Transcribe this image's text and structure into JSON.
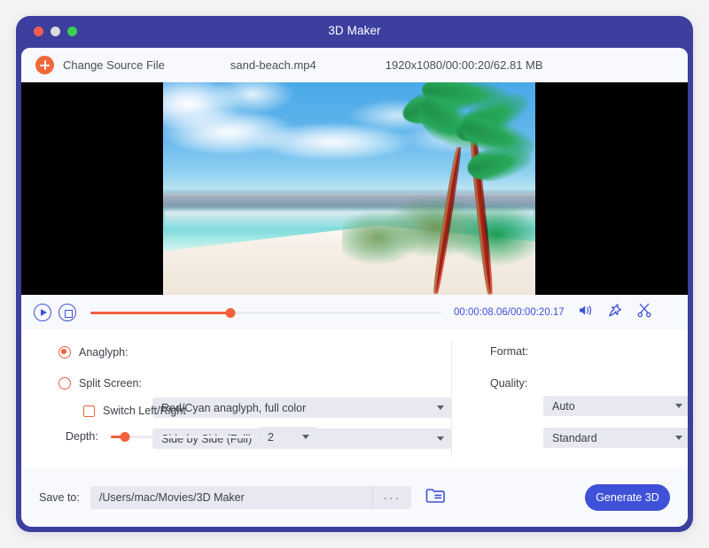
{
  "window": {
    "title": "3D Maker",
    "traffic_lights": [
      "close",
      "minimize",
      "zoom"
    ]
  },
  "source_bar": {
    "add_icon": "plus-circle-icon",
    "change_source_label": "Change Source File",
    "file_name": "sand-beach.mp4",
    "file_meta": "1920x1080/00:00:20/62.81 MB"
  },
  "preview": {
    "mode": "anaglyph-red-cyan",
    "letterbox": true
  },
  "player": {
    "play_icon": "play-circle-icon",
    "stop_icon": "stop-circle-icon",
    "progress_percent": 40,
    "time": "00:00:08.06/00:00:20.17",
    "volume_icon": "volume-icon",
    "snapshot_icon": "snapshot-pin-icon",
    "cut_icon": "scissors-icon"
  },
  "settings": {
    "anaglyph": {
      "label": "Anaglyph:",
      "selected": true,
      "value": "Red/Cyan anaglyph, full color"
    },
    "split_screen": {
      "label": "Split Screen:",
      "selected": false,
      "value": "Side by Side (Full)"
    },
    "switch_lr": {
      "label": "Switch Left/Right",
      "checked": false
    },
    "depth": {
      "label": "Depth:",
      "value": "2",
      "percent": 10
    },
    "format": {
      "label": "Format:",
      "value": "Auto"
    },
    "quality": {
      "label": "Quality:",
      "value": "Standard"
    }
  },
  "bottom": {
    "save_to_label": "Save to:",
    "path": "/Users/mac/Movies/3D Maker",
    "browse_label": "···",
    "folder_icon": "folder-icon",
    "generate_label": "Generate 3D"
  },
  "colors": {
    "frame": "#3c3f9e",
    "accent_blue": "#3f51d8",
    "accent_orange": "#f4603c",
    "plus_orange": "#f4673a"
  }
}
